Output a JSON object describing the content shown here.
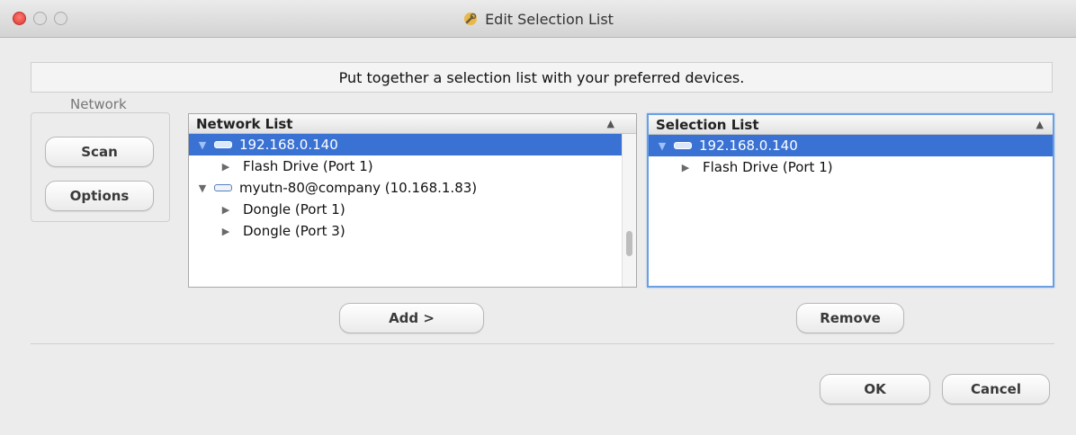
{
  "window": {
    "title": "Edit Selection List",
    "title_icon": "app-wrench-icon"
  },
  "instruction": "Put together a selection list with your preferred devices.",
  "network_group": {
    "label": "Network",
    "scan_label": "Scan",
    "options_label": "Options"
  },
  "network_list": {
    "header": "Network List",
    "sort_indicator": "▲",
    "rows": [
      {
        "label": "192.168.0.140",
        "expander": "▼",
        "icon": "network-device-icon",
        "selected": true
      },
      {
        "label": "Flash Drive (Port 1)",
        "expander": "▶"
      },
      {
        "label": "myutn-80@company (10.168.1.83)",
        "expander": "▼",
        "icon": "network-device-icon"
      },
      {
        "label": "Dongle (Port 1)",
        "expander": "▶"
      },
      {
        "label": "Dongle (Port 3)",
        "expander": "▶"
      }
    ]
  },
  "selection_list": {
    "header": "Selection List",
    "sort_indicator": "▲",
    "rows": [
      {
        "label": "192.168.0.140",
        "expander": "▼",
        "icon": "network-device-icon",
        "selected": true
      },
      {
        "label": "Flash Drive (Port 1)",
        "expander": "▶"
      }
    ]
  },
  "actions": {
    "add_label": "Add >",
    "remove_label": "Remove",
    "ok_label": "OK",
    "cancel_label": "Cancel"
  },
  "colors": {
    "selection_highlight": "#3a72d4",
    "focus_ring": "#6b9fe1",
    "close_button": "#e0443e"
  }
}
